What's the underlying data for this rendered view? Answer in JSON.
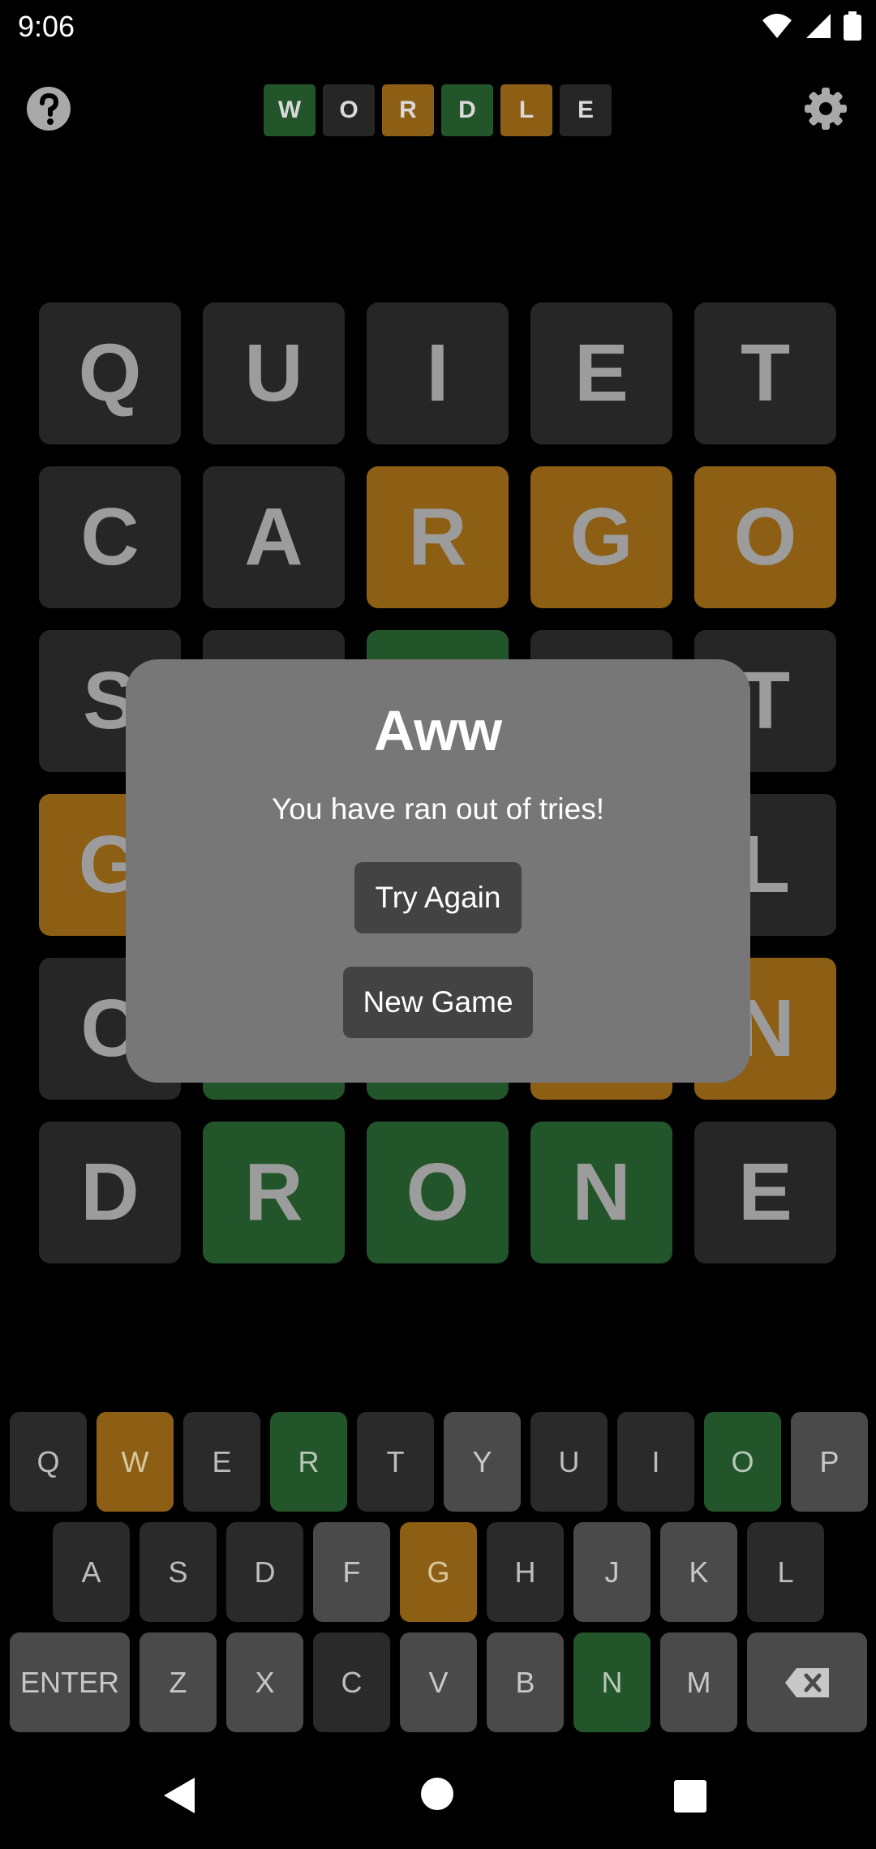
{
  "status_bar": {
    "time": "9:06"
  },
  "header": {
    "help_icon": "help-circle-icon",
    "settings_icon": "gear-icon",
    "logo": [
      {
        "letter": "W",
        "state": "correct"
      },
      {
        "letter": "O",
        "state": "absent"
      },
      {
        "letter": "R",
        "state": "present"
      },
      {
        "letter": "D",
        "state": "correct"
      },
      {
        "letter": "L",
        "state": "present"
      },
      {
        "letter": "E",
        "state": "absent"
      }
    ]
  },
  "board": {
    "rows": [
      [
        {
          "l": "Q",
          "s": "absent"
        },
        {
          "l": "U",
          "s": "absent"
        },
        {
          "l": "I",
          "s": "absent"
        },
        {
          "l": "E",
          "s": "absent"
        },
        {
          "l": "T",
          "s": "absent"
        }
      ],
      [
        {
          "l": "C",
          "s": "absent"
        },
        {
          "l": "A",
          "s": "absent"
        },
        {
          "l": "R",
          "s": "present"
        },
        {
          "l": "G",
          "s": "present"
        },
        {
          "l": "O",
          "s": "present"
        }
      ],
      [
        {
          "l": "S",
          "s": "absent"
        },
        {
          "l": "",
          "s": "absent"
        },
        {
          "l": "",
          "s": "correct"
        },
        {
          "l": "",
          "s": "absent"
        },
        {
          "l": "T",
          "s": "absent"
        }
      ],
      [
        {
          "l": "G",
          "s": "present"
        },
        {
          "l": "",
          "s": "absent"
        },
        {
          "l": "",
          "s": "absent"
        },
        {
          "l": "",
          "s": "absent"
        },
        {
          "l": "L",
          "s": "absent"
        }
      ],
      [
        {
          "l": "C",
          "s": "absent"
        },
        {
          "l": "",
          "s": "correct"
        },
        {
          "l": "",
          "s": "correct"
        },
        {
          "l": "",
          "s": "present"
        },
        {
          "l": "N",
          "s": "present"
        }
      ],
      [
        {
          "l": "D",
          "s": "absent"
        },
        {
          "l": "R",
          "s": "correct"
        },
        {
          "l": "O",
          "s": "correct"
        },
        {
          "l": "N",
          "s": "correct"
        },
        {
          "l": "E",
          "s": "absent"
        }
      ]
    ]
  },
  "dialog": {
    "title": "Aww",
    "message": "You have ran out of tries!",
    "try_again_label": "Try Again",
    "new_game_label": "New Game"
  },
  "keyboard": {
    "rows": [
      [
        {
          "k": "Q",
          "s": "absent"
        },
        {
          "k": "W",
          "s": "present"
        },
        {
          "k": "E",
          "s": "absent"
        },
        {
          "k": "R",
          "s": "correct"
        },
        {
          "k": "T",
          "s": "absent"
        },
        {
          "k": "Y",
          "s": "unused"
        },
        {
          "k": "U",
          "s": "absent"
        },
        {
          "k": "I",
          "s": "absent"
        },
        {
          "k": "O",
          "s": "correct"
        },
        {
          "k": "P",
          "s": "unused"
        }
      ],
      [
        {
          "k": "A",
          "s": "absent"
        },
        {
          "k": "S",
          "s": "absent"
        },
        {
          "k": "D",
          "s": "absent"
        },
        {
          "k": "F",
          "s": "unused"
        },
        {
          "k": "G",
          "s": "present"
        },
        {
          "k": "H",
          "s": "absent"
        },
        {
          "k": "J",
          "s": "unused"
        },
        {
          "k": "K",
          "s": "unused"
        },
        {
          "k": "L",
          "s": "absent"
        }
      ],
      [
        {
          "k": "ENTER",
          "s": "unused"
        },
        {
          "k": "Z",
          "s": "unused"
        },
        {
          "k": "X",
          "s": "unused"
        },
        {
          "k": "C",
          "s": "absent"
        },
        {
          "k": "V",
          "s": "unused"
        },
        {
          "k": "B",
          "s": "unused"
        },
        {
          "k": "N",
          "s": "correct"
        },
        {
          "k": "M",
          "s": "unused"
        },
        {
          "k": "",
          "s": "unused",
          "icon": "backspace-icon"
        }
      ]
    ]
  },
  "nav_bar": {
    "back_icon": "back-triangle-icon",
    "home_icon": "home-circle-icon",
    "recents_icon": "recents-square-icon"
  },
  "colors": {
    "correct": "#23552a",
    "present": "#8d5f15",
    "absent": "#262626",
    "unused_key": "#4a4a4a",
    "dialog_bg": "#777777"
  }
}
